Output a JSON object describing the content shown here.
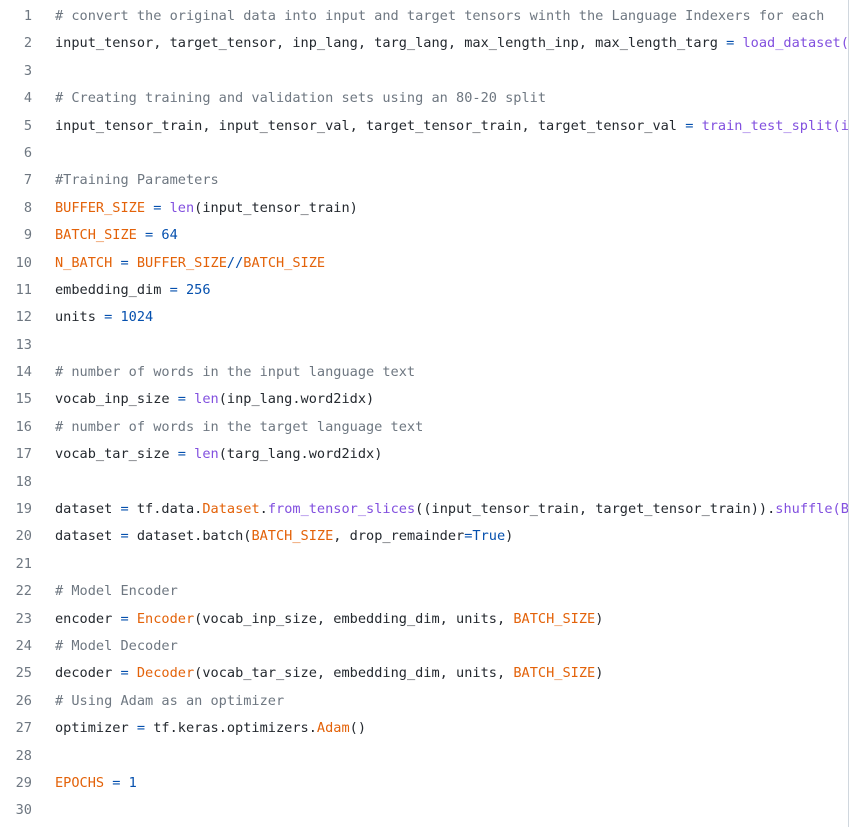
{
  "editor": {
    "language": "python",
    "colors": {
      "comment": "#6e7781",
      "constant": "#e36209",
      "call": "#8250df",
      "number": "#0550ae",
      "text": "#24292f",
      "line_number": "#6e7781"
    },
    "lines": [
      {
        "n": "1",
        "tokens": [
          {
            "t": "# convert the original data into input and target tensors winth the Language Indexers for each",
            "c": "comment"
          }
        ]
      },
      {
        "n": "2",
        "tokens": [
          {
            "t": "input_tensor, target_tensor, inp_lang, targ_lang, max_length_inp, max_length_targ ",
            "c": "plain"
          },
          {
            "t": "=",
            "c": "op"
          },
          {
            "t": " ",
            "c": "plain"
          },
          {
            "t": "load_dataset(",
            "c": "call"
          }
        ]
      },
      {
        "n": "3",
        "tokens": []
      },
      {
        "n": "4",
        "tokens": [
          {
            "t": "# Creating training and validation sets using an 80-20 split",
            "c": "comment"
          }
        ]
      },
      {
        "n": "5",
        "tokens": [
          {
            "t": "input_tensor_train, input_tensor_val, target_tensor_train, target_tensor_val ",
            "c": "plain"
          },
          {
            "t": "=",
            "c": "op"
          },
          {
            "t": " ",
            "c": "plain"
          },
          {
            "t": "train_test_split(i",
            "c": "call"
          }
        ]
      },
      {
        "n": "6",
        "tokens": []
      },
      {
        "n": "7",
        "tokens": [
          {
            "t": "#Training Parameters",
            "c": "comment"
          }
        ]
      },
      {
        "n": "8",
        "tokens": [
          {
            "t": "BUFFER_SIZE",
            "c": "const"
          },
          {
            "t": " ",
            "c": "plain"
          },
          {
            "t": "=",
            "c": "op"
          },
          {
            "t": " ",
            "c": "plain"
          },
          {
            "t": "len",
            "c": "call"
          },
          {
            "t": "(input_tensor_train)",
            "c": "plain"
          }
        ]
      },
      {
        "n": "9",
        "tokens": [
          {
            "t": "BATCH_SIZE",
            "c": "const"
          },
          {
            "t": " ",
            "c": "plain"
          },
          {
            "t": "=",
            "c": "op"
          },
          {
            "t": " ",
            "c": "plain"
          },
          {
            "t": "64",
            "c": "num"
          }
        ]
      },
      {
        "n": "10",
        "tokens": [
          {
            "t": "N_BATCH",
            "c": "const"
          },
          {
            "t": " ",
            "c": "plain"
          },
          {
            "t": "=",
            "c": "op"
          },
          {
            "t": " ",
            "c": "plain"
          },
          {
            "t": "BUFFER_SIZE",
            "c": "const"
          },
          {
            "t": "//",
            "c": "op"
          },
          {
            "t": "BATCH_SIZE",
            "c": "const"
          }
        ]
      },
      {
        "n": "11",
        "tokens": [
          {
            "t": "embedding_dim ",
            "c": "plain"
          },
          {
            "t": "=",
            "c": "op"
          },
          {
            "t": " ",
            "c": "plain"
          },
          {
            "t": "256",
            "c": "num"
          }
        ]
      },
      {
        "n": "12",
        "tokens": [
          {
            "t": "units ",
            "c": "plain"
          },
          {
            "t": "=",
            "c": "op"
          },
          {
            "t": " ",
            "c": "plain"
          },
          {
            "t": "1024",
            "c": "num"
          }
        ]
      },
      {
        "n": "13",
        "tokens": []
      },
      {
        "n": "14",
        "tokens": [
          {
            "t": "# number of words in the input language text",
            "c": "comment"
          }
        ]
      },
      {
        "n": "15",
        "tokens": [
          {
            "t": "vocab_inp_size ",
            "c": "plain"
          },
          {
            "t": "=",
            "c": "op"
          },
          {
            "t": " ",
            "c": "plain"
          },
          {
            "t": "len",
            "c": "call"
          },
          {
            "t": "(inp_lang.word2idx)",
            "c": "plain"
          }
        ]
      },
      {
        "n": "16",
        "tokens": [
          {
            "t": "# number of words in the target language text",
            "c": "comment"
          }
        ]
      },
      {
        "n": "17",
        "tokens": [
          {
            "t": "vocab_tar_size ",
            "c": "plain"
          },
          {
            "t": "=",
            "c": "op"
          },
          {
            "t": " ",
            "c": "plain"
          },
          {
            "t": "len",
            "c": "call"
          },
          {
            "t": "(targ_lang.word2idx)",
            "c": "plain"
          }
        ]
      },
      {
        "n": "18",
        "tokens": []
      },
      {
        "n": "19",
        "tokens": [
          {
            "t": "dataset ",
            "c": "plain"
          },
          {
            "t": "=",
            "c": "op"
          },
          {
            "t": " tf.data.",
            "c": "plain"
          },
          {
            "t": "Dataset",
            "c": "const"
          },
          {
            "t": ".",
            "c": "plain"
          },
          {
            "t": "from_tensor_slices",
            "c": "call"
          },
          {
            "t": "((input_tensor_train, target_tensor_train)).",
            "c": "plain"
          },
          {
            "t": "shuffle(B",
            "c": "call"
          }
        ]
      },
      {
        "n": "20",
        "tokens": [
          {
            "t": "dataset ",
            "c": "plain"
          },
          {
            "t": "=",
            "c": "op"
          },
          {
            "t": " dataset.batch(",
            "c": "plain"
          },
          {
            "t": "BATCH_SIZE",
            "c": "const"
          },
          {
            "t": ", drop_remainder",
            "c": "plain"
          },
          {
            "t": "=",
            "c": "op"
          },
          {
            "t": "True",
            "c": "kw"
          },
          {
            "t": ")",
            "c": "plain"
          }
        ]
      },
      {
        "n": "21",
        "tokens": []
      },
      {
        "n": "22",
        "tokens": [
          {
            "t": "# Model Encoder",
            "c": "comment"
          }
        ]
      },
      {
        "n": "23",
        "tokens": [
          {
            "t": "encoder ",
            "c": "plain"
          },
          {
            "t": "=",
            "c": "op"
          },
          {
            "t": " ",
            "c": "plain"
          },
          {
            "t": "Encoder",
            "c": "const"
          },
          {
            "t": "(vocab_inp_size, embedding_dim, units, ",
            "c": "plain"
          },
          {
            "t": "BATCH_SIZE",
            "c": "const"
          },
          {
            "t": ")",
            "c": "plain"
          }
        ]
      },
      {
        "n": "24",
        "tokens": [
          {
            "t": "# Model Decoder",
            "c": "comment"
          }
        ]
      },
      {
        "n": "25",
        "tokens": [
          {
            "t": "decoder ",
            "c": "plain"
          },
          {
            "t": "=",
            "c": "op"
          },
          {
            "t": " ",
            "c": "plain"
          },
          {
            "t": "Decoder",
            "c": "const"
          },
          {
            "t": "(vocab_tar_size, embedding_dim, units, ",
            "c": "plain"
          },
          {
            "t": "BATCH_SIZE",
            "c": "const"
          },
          {
            "t": ")",
            "c": "plain"
          }
        ]
      },
      {
        "n": "26",
        "tokens": [
          {
            "t": "# Using Adam as an optimizer",
            "c": "comment"
          }
        ]
      },
      {
        "n": "27",
        "tokens": [
          {
            "t": "optimizer ",
            "c": "plain"
          },
          {
            "t": "=",
            "c": "op"
          },
          {
            "t": " tf.keras.optimizers.",
            "c": "plain"
          },
          {
            "t": "Adam",
            "c": "const"
          },
          {
            "t": "()",
            "c": "plain"
          }
        ]
      },
      {
        "n": "28",
        "tokens": []
      },
      {
        "n": "29",
        "tokens": [
          {
            "t": "EPOCHS",
            "c": "const"
          },
          {
            "t": " ",
            "c": "plain"
          },
          {
            "t": "=",
            "c": "op"
          },
          {
            "t": " ",
            "c": "plain"
          },
          {
            "t": "1",
            "c": "num"
          }
        ]
      },
      {
        "n": "30",
        "tokens": []
      }
    ]
  }
}
